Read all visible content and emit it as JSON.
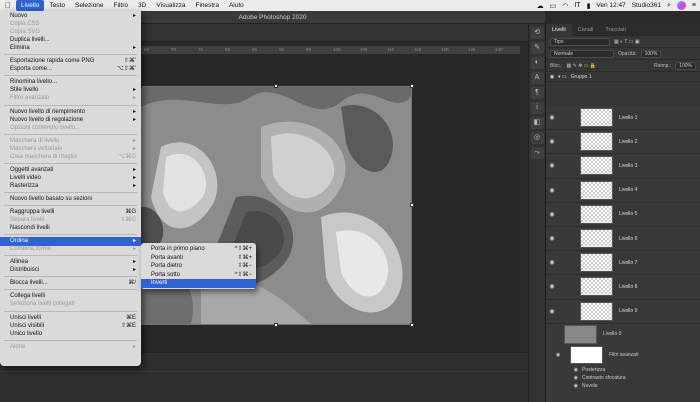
{
  "menubar": {
    "items": [
      "Livello",
      "Testo",
      "Selezione",
      "Filtro",
      "3D",
      "Visualizza",
      "Finestra",
      "Aiuto"
    ],
    "active": "Livello",
    "status": {
      "lang_flag": "IT",
      "time": "Ven 12:47",
      "user": "Studio361"
    }
  },
  "window": {
    "title": "Adobe Photoshop 2020"
  },
  "ruler": {
    "marks": [
      "65",
      "70",
      "75",
      "80",
      "85",
      "90",
      "95",
      "100",
      "105",
      "110",
      "115",
      "120",
      "125",
      "130"
    ]
  },
  "layer_menu": [
    {
      "label": "Nuovo",
      "arrow": true
    },
    {
      "label": "Copia CSS",
      "disabled": true
    },
    {
      "label": "Copia SVG",
      "disabled": true
    },
    {
      "label": "Duplica livelli..."
    },
    {
      "label": "Elimina",
      "arrow": true
    },
    {
      "sep": true
    },
    {
      "label": "Esportazione rapida come PNG",
      "shortcut": "⇧⌘'"
    },
    {
      "label": "Esporta come...",
      "shortcut": "⌥⇧⌘'"
    },
    {
      "sep": true
    },
    {
      "label": "Rinomina livello..."
    },
    {
      "label": "Stile livello",
      "arrow": true
    },
    {
      "label": "Filtro avanzato",
      "disabled": true,
      "arrow": true
    },
    {
      "sep": true
    },
    {
      "label": "Nuovo livello di riempimento",
      "arrow": true
    },
    {
      "label": "Nuovo livello di regolazione",
      "arrow": true
    },
    {
      "label": "Opzioni contenuto livello...",
      "disabled": true
    },
    {
      "sep": true
    },
    {
      "label": "Maschera di livello",
      "disabled": true,
      "arrow": true
    },
    {
      "label": "Maschera vettoriale",
      "disabled": true,
      "arrow": true
    },
    {
      "label": "Crea maschera di ritaglio",
      "disabled": true,
      "shortcut": "⌥⌘G"
    },
    {
      "sep": true
    },
    {
      "label": "Oggetti avanzati",
      "arrow": true
    },
    {
      "label": "Livelli video",
      "arrow": true
    },
    {
      "label": "Rasterizza",
      "arrow": true
    },
    {
      "sep": true
    },
    {
      "label": "Nuovo livello basato su sezioni"
    },
    {
      "sep": true
    },
    {
      "label": "Raggruppa livelli",
      "shortcut": "⌘G"
    },
    {
      "label": "Separa livelli",
      "disabled": true,
      "shortcut": "⇧⌘G"
    },
    {
      "label": "Nascondi livelli"
    },
    {
      "sep": true
    },
    {
      "label": "Ordina",
      "arrow": true,
      "highlight": true
    },
    {
      "label": "Combina forme",
      "disabled": true,
      "arrow": true
    },
    {
      "sep": true
    },
    {
      "label": "Allinea",
      "arrow": true
    },
    {
      "label": "Distribuisci",
      "arrow": true
    },
    {
      "sep": true
    },
    {
      "label": "Blocca livelli...",
      "shortcut": "⌘/"
    },
    {
      "sep": true
    },
    {
      "label": "Collega livelli"
    },
    {
      "label": "Seleziona livelli collegati",
      "disabled": true
    },
    {
      "sep": true
    },
    {
      "label": "Unisci livelli",
      "shortcut": "⌘E"
    },
    {
      "label": "Unisci visibili",
      "shortcut": "⇧⌘E"
    },
    {
      "label": "Unico livello"
    },
    {
      "sep": true
    },
    {
      "label": "Alone",
      "disabled": true,
      "arrow": true
    }
  ],
  "submenu": [
    {
      "label": "Porta in primo piano",
      "shortcut": "^⇧⌘+"
    },
    {
      "label": "Porta avanti",
      "shortcut": "⇧⌘+"
    },
    {
      "label": "Porta dietro",
      "shortcut": "⇧⌘−"
    },
    {
      "label": "Porta sotto",
      "shortcut": "^⇧⌘−"
    },
    {
      "label": "Inverti",
      "highlight": true
    }
  ],
  "layers_panel": {
    "tabs": [
      "Livelli",
      "Canali",
      "Tracciati"
    ],
    "filter": "Tipo",
    "blend": "Normale",
    "opacity_label": "Opacità:",
    "opacity": "100%",
    "lock_label": "Bloc.:",
    "fill_label": "Riemp.:",
    "fill": "100%",
    "group": "Gruppo 1",
    "layers": [
      "Livello 1",
      "Livello 2",
      "Livello 3",
      "Livello 4",
      "Livello 5",
      "Livello 6",
      "Livello 7",
      "Livello 8",
      "Livello 9"
    ],
    "base_layer": "Livello 0",
    "smart_filters": "Filtri avanzati",
    "filters": [
      "Posterizza",
      "Contrasto sfocatura",
      "Nuvole"
    ]
  }
}
